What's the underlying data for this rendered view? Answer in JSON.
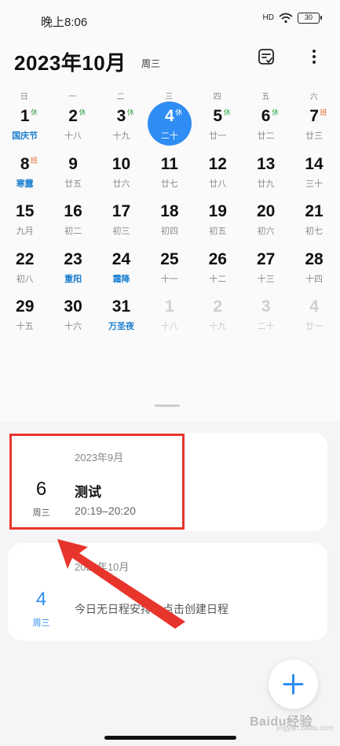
{
  "status_bar": {
    "time": "晚上8:06",
    "signal": "HD",
    "battery": "30"
  },
  "header": {
    "title": "2023年10月",
    "weekday": "周三"
  },
  "week_days": [
    "日",
    "一",
    "二",
    "三",
    "四",
    "五",
    "六"
  ],
  "weeks": [
    [
      {
        "day": "1",
        "lunar": "国庆节",
        "festival": true,
        "tag": "休",
        "tag_type": "rest"
      },
      {
        "day": "2",
        "lunar": "十八",
        "tag": "休",
        "tag_type": "rest"
      },
      {
        "day": "3",
        "lunar": "十九",
        "tag": "休",
        "tag_type": "rest"
      },
      {
        "day": "4",
        "lunar": "二十",
        "tag": "休",
        "tag_type": "rest",
        "today": true
      },
      {
        "day": "5",
        "lunar": "廿一",
        "tag": "休",
        "tag_type": "rest"
      },
      {
        "day": "6",
        "lunar": "廿二",
        "tag": "休",
        "tag_type": "rest"
      },
      {
        "day": "7",
        "lunar": "廿三",
        "tag": "班",
        "tag_type": "work"
      }
    ],
    [
      {
        "day": "8",
        "lunar": "寒露",
        "festival": true,
        "tag": "班",
        "tag_type": "work"
      },
      {
        "day": "9",
        "lunar": "廿五"
      },
      {
        "day": "10",
        "lunar": "廿六"
      },
      {
        "day": "11",
        "lunar": "廿七"
      },
      {
        "day": "12",
        "lunar": "廿八"
      },
      {
        "day": "13",
        "lunar": "廿九"
      },
      {
        "day": "14",
        "lunar": "三十"
      }
    ],
    [
      {
        "day": "15",
        "lunar": "九月"
      },
      {
        "day": "16",
        "lunar": "初二"
      },
      {
        "day": "17",
        "lunar": "初三"
      },
      {
        "day": "18",
        "lunar": "初四"
      },
      {
        "day": "19",
        "lunar": "初五"
      },
      {
        "day": "20",
        "lunar": "初六"
      },
      {
        "day": "21",
        "lunar": "初七"
      }
    ],
    [
      {
        "day": "22",
        "lunar": "初八"
      },
      {
        "day": "23",
        "lunar": "重阳",
        "festival": true
      },
      {
        "day": "24",
        "lunar": "霜降",
        "festival": true
      },
      {
        "day": "25",
        "lunar": "十一"
      },
      {
        "day": "26",
        "lunar": "十二"
      },
      {
        "day": "27",
        "lunar": "十三"
      },
      {
        "day": "28",
        "lunar": "十四"
      }
    ],
    [
      {
        "day": "29",
        "lunar": "十五"
      },
      {
        "day": "30",
        "lunar": "十六"
      },
      {
        "day": "31",
        "lunar": "万圣夜",
        "festival": true
      },
      {
        "day": "1",
        "lunar": "十八",
        "other": true
      },
      {
        "day": "2",
        "lunar": "十九",
        "other": true
      },
      {
        "day": "3",
        "lunar": "二十",
        "other": true
      },
      {
        "day": "4",
        "lunar": "廿一",
        "other": true
      }
    ]
  ],
  "events": {
    "card1": {
      "month": "2023年9月",
      "day": "6",
      "weekday": "周三",
      "title": "测试",
      "time": "20:19–20:20"
    },
    "card2": {
      "month": "2023年10月",
      "day": "4",
      "weekday": "周三",
      "text": "今日无日程安排，点击创建日程"
    }
  },
  "watermark": {
    "text": "Baidu经验",
    "sub": "jingyan.baidu.com"
  },
  "colors": {
    "accent": "#2f8df3",
    "festival": "#1a7fd0",
    "rest": "#3aa54a",
    "work": "#e0682a",
    "annotation": "#e8352c"
  },
  "icons": {
    "note": "note-check-icon",
    "more": "more-vertical-icon",
    "add": "plus-icon"
  }
}
